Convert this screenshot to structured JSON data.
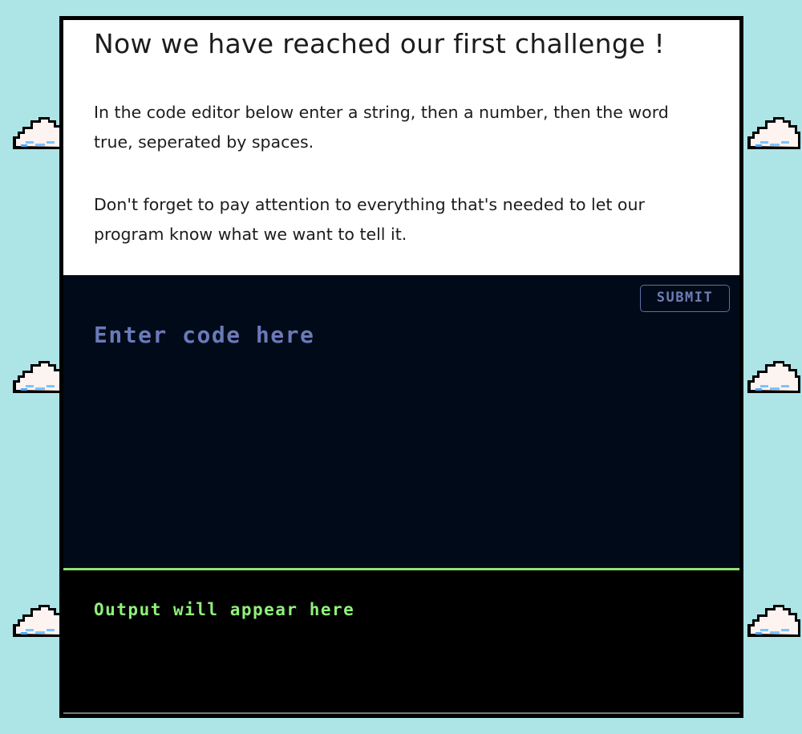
{
  "challenge": {
    "title": "Now we have reached our first challenge !",
    "paragraph_1": "In the code editor below enter a string, then a number, then the word true, seperated by spaces.",
    "paragraph_2": "Don't forget to pay attention to everything that's needed to let our program know what we want to tell it."
  },
  "editor": {
    "submit_label": "SUBMIT",
    "placeholder": "Enter code here"
  },
  "output": {
    "placeholder": "Output will appear here"
  },
  "colors": {
    "background": "#ade4e6",
    "editor_background": "#010a19",
    "placeholder_text": "#6a7ab8",
    "output_text": "#8ff07a",
    "divider": "#8fe26f"
  },
  "decorations": {
    "background_icon": "pixel-cloud-icon"
  }
}
